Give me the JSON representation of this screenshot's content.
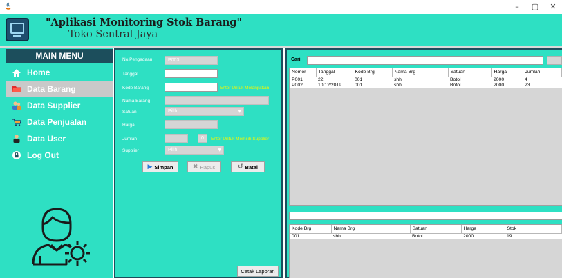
{
  "window": {
    "controls": {
      "minimize": "–",
      "maximize": "▢",
      "close": "✕"
    }
  },
  "header": {
    "title": "\"Aplikasi Monitoring Stok Barang\"",
    "subtitle": "Toko Sentral Jaya"
  },
  "sidebar": {
    "menu_title": "MAIN MENU",
    "items": [
      {
        "label": "Home",
        "icon": "home-icon",
        "active": false
      },
      {
        "label": "Data Barang",
        "icon": "folder-icon",
        "active": true
      },
      {
        "label": "Data Supplier",
        "icon": "people-icon",
        "active": false
      },
      {
        "label": "Data Penjualan",
        "icon": "cart-icon",
        "active": false
      },
      {
        "label": "Data User",
        "icon": "user-icon",
        "active": false
      },
      {
        "label": "Log Out",
        "icon": "lock-icon",
        "active": false
      }
    ]
  },
  "form": {
    "no_pengadaan": {
      "label": "No.Pengadaan",
      "value": "P003"
    },
    "tanggal": {
      "label": "Tanggal",
      "value": ""
    },
    "kode_barang": {
      "label": "Kode Barang",
      "value": "",
      "hint": "Enter Untuk Melanjutkan"
    },
    "nama_barang": {
      "label": "Nama Barang",
      "value": ""
    },
    "satuan": {
      "label": "Satuan",
      "value": "Pilih"
    },
    "harga": {
      "label": "Harga",
      "value": ""
    },
    "jumlah": {
      "label": "Jumlah",
      "value": "",
      "count": "0",
      "hint": "Enter Untuk Memilih Supplier"
    },
    "supplier": {
      "label": "Supplier",
      "value": "Pilih"
    },
    "buttons": {
      "simpan": "Simpan",
      "hapus": "Hapus",
      "batal": "Batal"
    },
    "cetak": "Cetak Laporan"
  },
  "search": {
    "label": "Cari",
    "button": "..."
  },
  "pengadaan_table": {
    "columns": [
      "Nomor",
      "Tanggal",
      "Kode Brg",
      "Nama Brg",
      "Satuan",
      "Harga",
      "Jumlah"
    ],
    "rows": [
      [
        "P001",
        "22",
        "001",
        "shh",
        "Botol",
        "2000",
        "4"
      ],
      [
        "P002",
        "10/12/2019",
        "001",
        "shh",
        "Botol",
        "2000",
        "23"
      ]
    ]
  },
  "stok_table": {
    "columns": [
      "Kode Brg",
      "Nama Brg",
      "Satuan",
      "Harga",
      "Stok"
    ],
    "rows": [
      [
        "001",
        "shh",
        "Botol",
        "2000",
        "19"
      ]
    ]
  },
  "colors": {
    "accent": "#2ee0c3",
    "menu_header": "#1c4e5c",
    "hint": "#f4f800"
  }
}
